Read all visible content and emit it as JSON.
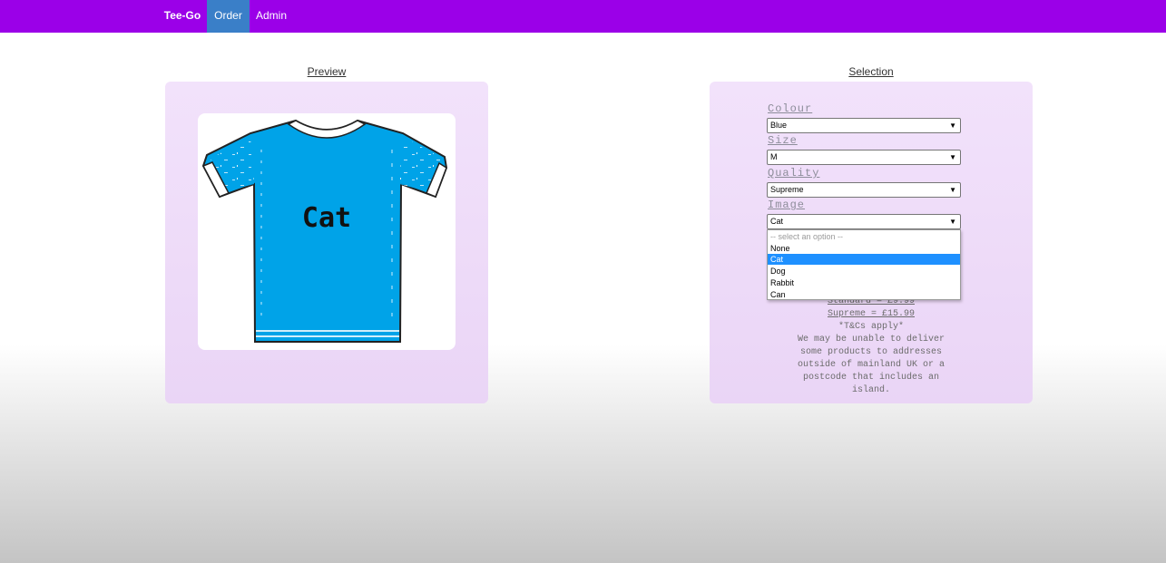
{
  "nav": {
    "brand": "Tee-Go",
    "items": [
      {
        "label": "Order",
        "active": true
      },
      {
        "label": "Admin",
        "active": false
      }
    ],
    "color": "#9b00e8",
    "active_color": "#3a7fc8"
  },
  "preview": {
    "title": "Preview",
    "shirt": {
      "colour": "#00a3e8",
      "text": "Cat"
    }
  },
  "selection": {
    "title": "Selection",
    "fields": [
      {
        "label": "Colour",
        "value": "Blue"
      },
      {
        "label": "Size",
        "value": "M"
      },
      {
        "label": "Quality",
        "value": "Supreme"
      },
      {
        "label": "Image",
        "value": "Cat"
      }
    ],
    "image_dropdown": {
      "placeholder": "-- select an option --",
      "options": [
        "None",
        "Cat",
        "Dog",
        "Rabbit",
        "Can"
      ],
      "selected": "Cat"
    },
    "prices": {
      "standard": "Standard = £9.99",
      "supreme": "Supreme = £15.99"
    },
    "tcs": "*T&Cs apply*",
    "notice_lines": [
      "We may be unable to deliver",
      "some products to addresses",
      "outside of mainland UK or a",
      "postcode that includes an",
      "island."
    ]
  }
}
